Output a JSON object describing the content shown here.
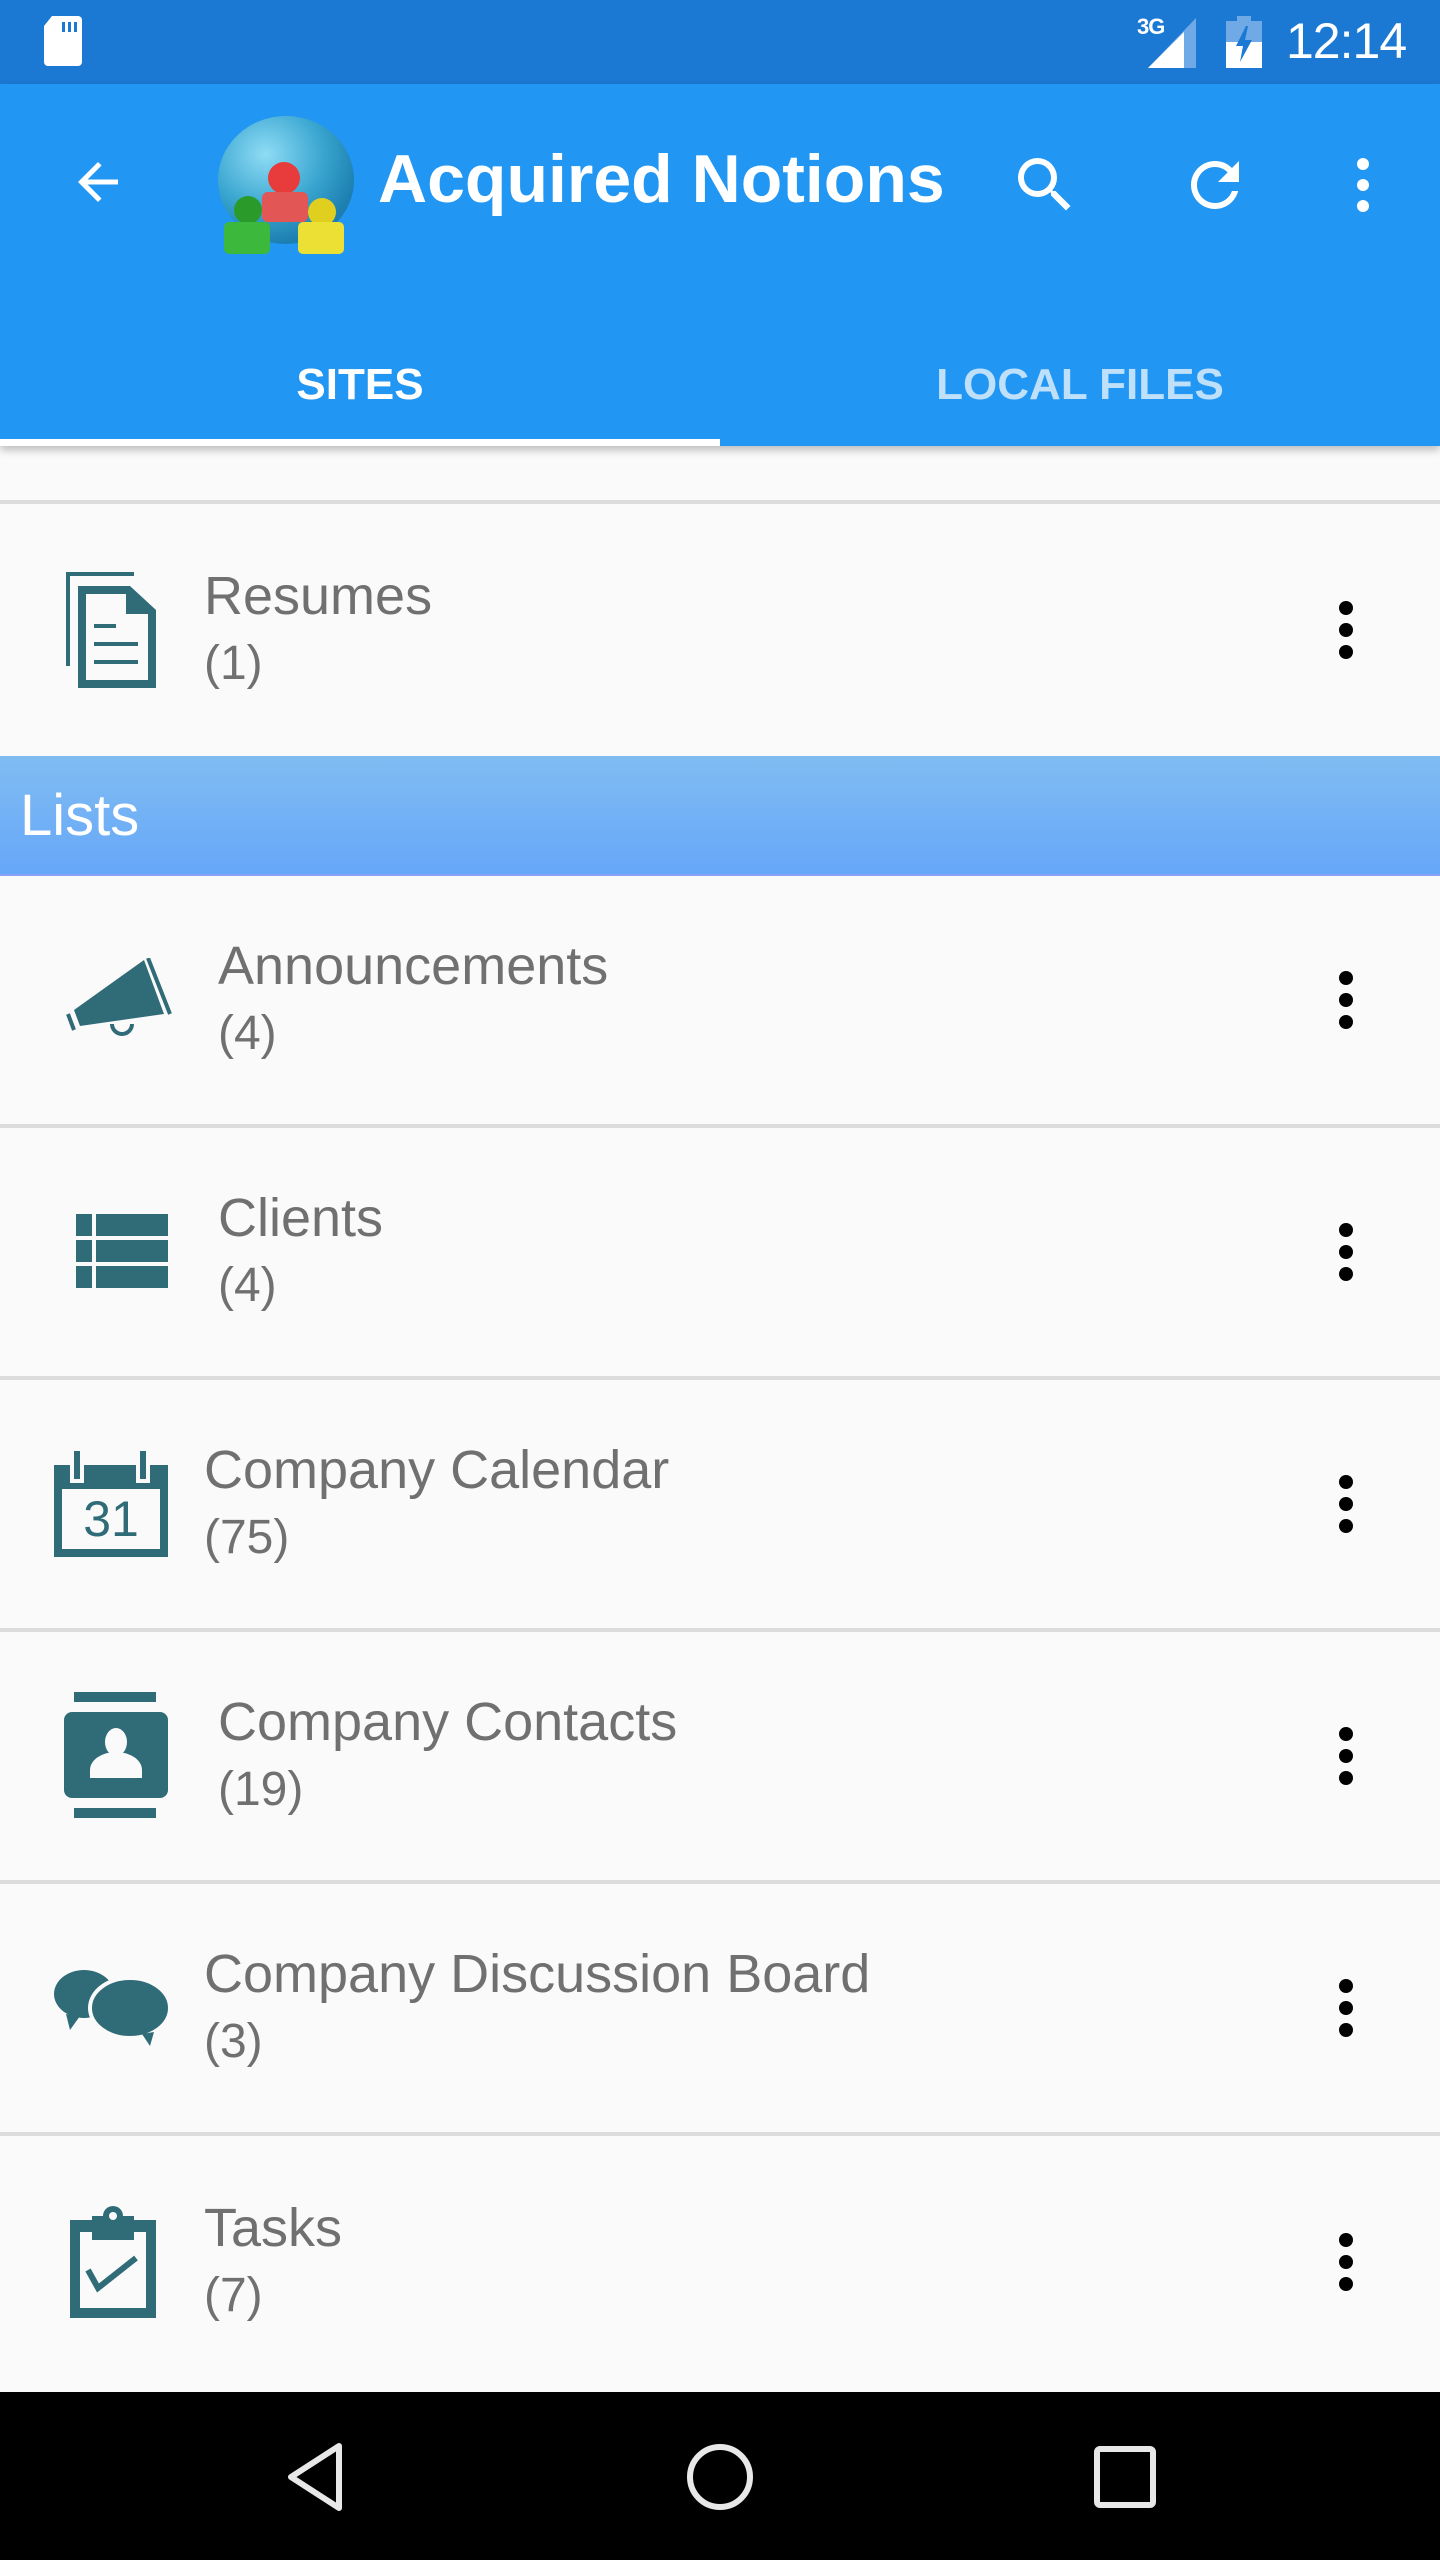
{
  "status_bar": {
    "network": "3G",
    "time": "12:14",
    "icons": [
      "sd-card-icon",
      "signal-icon",
      "battery-charging-icon"
    ]
  },
  "app_bar": {
    "title": "Acquired Notions",
    "back_icon": "arrow-back-icon",
    "logo": "app-logo-people-globe",
    "actions": [
      {
        "name": "search",
        "icon": "search-icon"
      },
      {
        "name": "refresh",
        "icon": "refresh-icon"
      },
      {
        "name": "more",
        "icon": "more-vert-icon"
      }
    ]
  },
  "tabs": [
    {
      "label": "SITES",
      "active": true
    },
    {
      "label": "LOCAL FILES",
      "active": false
    }
  ],
  "colors": {
    "primary": "#2196f3",
    "status_bar": "#1c79d3",
    "icon_teal": "#306b78",
    "text_secondary": "#707070"
  },
  "libraries": [
    {
      "title": "Resumes",
      "count": "(1)",
      "icon": "documents-icon"
    }
  ],
  "lists_section": {
    "header": "Lists",
    "items": [
      {
        "title": "Announcements",
        "count": "(4)",
        "icon": "megaphone-icon"
      },
      {
        "title": "Clients",
        "count": "(4)",
        "icon": "list-table-icon"
      },
      {
        "title": "Company Calendar",
        "count": "(75)",
        "icon": "calendar-icon",
        "calendar_day": "31"
      },
      {
        "title": "Company Contacts",
        "count": "(19)",
        "icon": "contact-card-icon"
      },
      {
        "title": "Company Discussion Board",
        "count": "(3)",
        "icon": "chat-bubbles-icon"
      },
      {
        "title": "Tasks",
        "count": "(7)",
        "icon": "clipboard-check-icon"
      }
    ]
  },
  "nav_bar": {
    "buttons": [
      "back",
      "home",
      "recents"
    ]
  }
}
